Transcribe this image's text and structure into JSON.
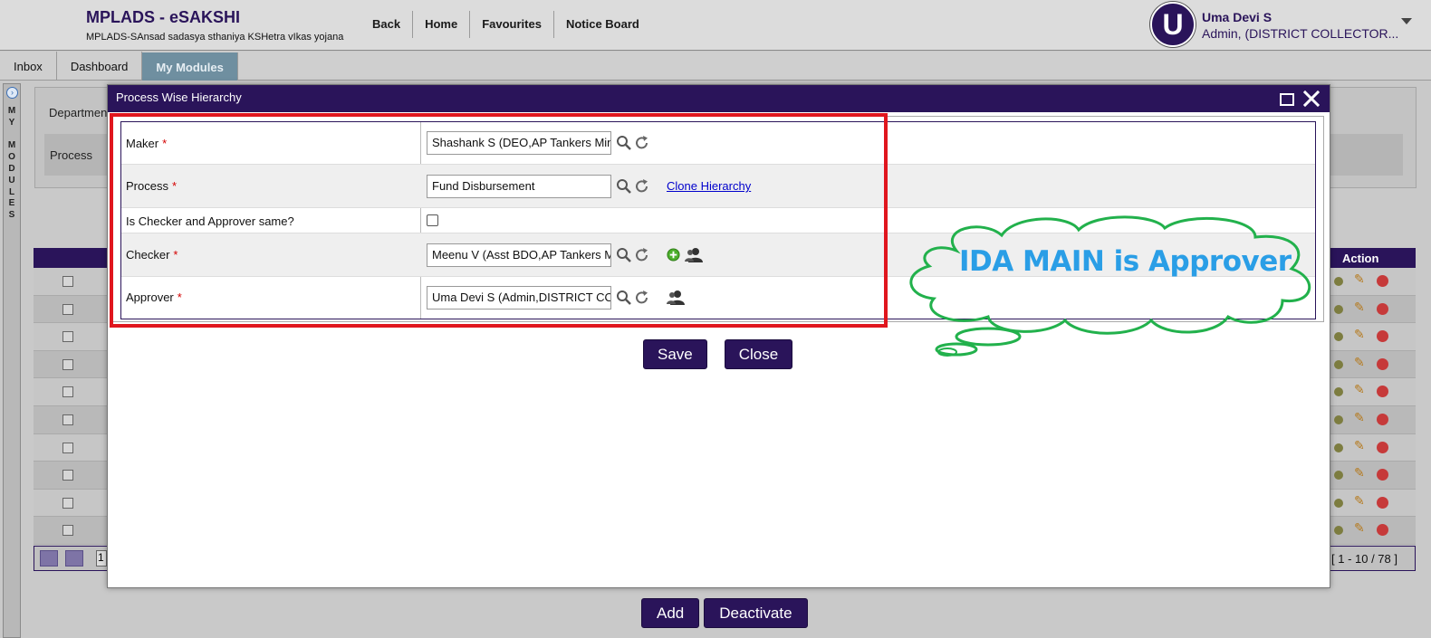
{
  "header": {
    "app_title": "MPLADS - eSAKSHI",
    "app_subtitle": "MPLADS-SAnsad sadasya sthaniya KSHetra vIkas yojana",
    "nav": [
      "Back",
      "Home",
      "Favourites",
      "Notice Board"
    ],
    "user": {
      "avatar_letter": "U",
      "name": "Uma Devi S",
      "role": "Admin, (DISTRICT COLLECTOR..."
    }
  },
  "tabs": [
    "Inbox",
    "Dashboard",
    "My Modules"
  ],
  "active_tab": "My Modules",
  "side_strip": {
    "label": "M\nY\n\nM\nO\nD\nU\nL\nE\nS"
  },
  "background_page": {
    "department_label": "Departmen",
    "process_label": "Process",
    "grid_action_header": "Action",
    "grid_row_count": 10,
    "pager_page": "1",
    "pager_summary": "[ 1 - 10 / 78 ]",
    "buttons": {
      "add": "Add",
      "deactivate": "Deactivate"
    }
  },
  "modal": {
    "title": "Process Wise Hierarchy",
    "fields": {
      "maker": {
        "label": "Maker",
        "value": "Shashank S (DEO,AP Tankers Mini"
      },
      "process": {
        "label": "Process",
        "value": "Fund Disbursement",
        "link": "Clone Hierarchy"
      },
      "same_checker": {
        "label": "Is Checker and Approver same?",
        "checked": false
      },
      "checker": {
        "label": "Checker",
        "value": "Meenu V (Asst BDO,AP Tankers M"
      },
      "approver": {
        "label": "Approver",
        "value": "Uma Devi S (Admin,DISTRICT COLL"
      }
    },
    "required_mark": "*",
    "buttons": {
      "save": "Save",
      "close": "Close"
    }
  },
  "annotation": {
    "text": "IDA MAIN is Approver",
    "cloud_color": "#22b14c",
    "text_color": "#2a9ee6",
    "highlight_color": "#e0161e"
  },
  "colors": {
    "brand": "#2a145a",
    "active_tab": "#6f8fa0"
  }
}
